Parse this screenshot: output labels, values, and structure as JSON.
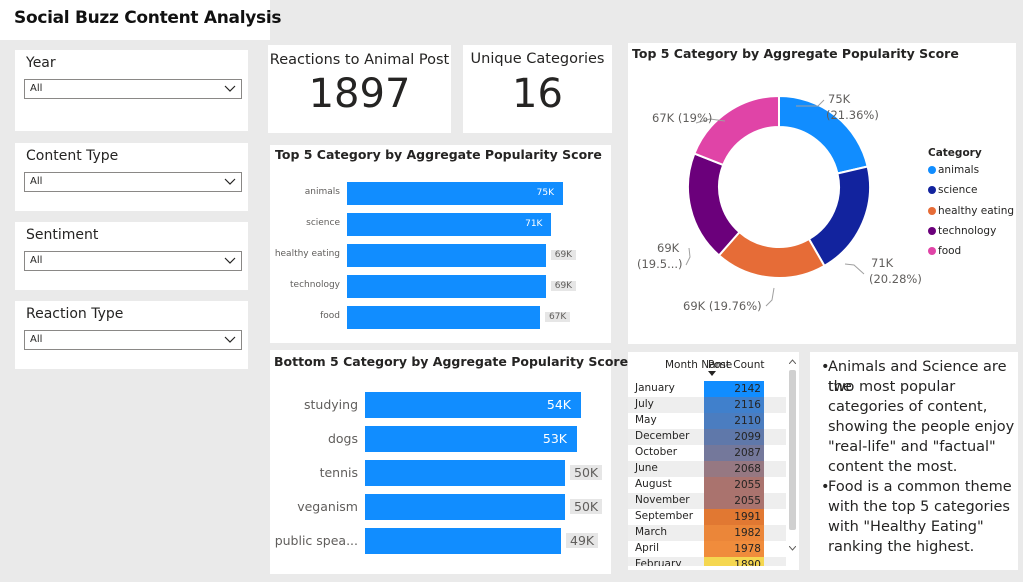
{
  "title": "Social Buzz Content Analysis",
  "slicers": [
    {
      "label": "Year",
      "value": "All"
    },
    {
      "label": "Content Type",
      "value": "All"
    },
    {
      "label": "Sentiment",
      "value": "All"
    },
    {
      "label": "Reaction Type",
      "value": "All"
    }
  ],
  "kpis": {
    "reactions": {
      "label": "Reactions to Animal Post",
      "value": "1897"
    },
    "categories": {
      "label": "Unique Categories",
      "value": "16"
    }
  },
  "top5_title": "Top 5 Category by Aggregate Popularity Score",
  "bottom5_title": "Bottom 5 Category by Aggregate Popularity Score",
  "donut_title": "Top 5 Category by Aggregate Popularity Score",
  "legend": {
    "title": "Category",
    "items": [
      "animals",
      "science",
      "healthy eating",
      "technology",
      "food"
    ]
  },
  "donut_labels": {
    "animals": [
      "75K",
      "(21.36%)"
    ],
    "science": [
      "71K",
      "(20.28%)"
    ],
    "healthy_eating": [
      "69K (19.76%)"
    ],
    "technology": [
      "69K",
      "(19.5...)"
    ],
    "food": [
      "67K (19%)"
    ]
  },
  "month_table": {
    "headers": [
      "Month Name",
      "Post Count"
    ],
    "rows": [
      {
        "month": "January",
        "count": "2142"
      },
      {
        "month": "July",
        "count": "2116"
      },
      {
        "month": "May",
        "count": "2110"
      },
      {
        "month": "December",
        "count": "2099"
      },
      {
        "month": "October",
        "count": "2087"
      },
      {
        "month": "June",
        "count": "2068"
      },
      {
        "month": "August",
        "count": "2055"
      },
      {
        "month": "November",
        "count": "2055"
      },
      {
        "month": "September",
        "count": "1991"
      },
      {
        "month": "March",
        "count": "1982"
      },
      {
        "month": "April",
        "count": "1978"
      },
      {
        "month": "February",
        "count": "1890"
      }
    ]
  },
  "notes": [
    [
      "Animals and Science are the",
      "two most popular",
      "categories of content,",
      "showing the people enjoy",
      "\"real-life\" and \"factual\"",
      "content the most."
    ],
    [
      "Food is a common theme",
      "with the top 5 categories",
      "with \"Healthy Eating\"",
      "ranking the highest."
    ]
  ],
  "colors": {
    "bar": "#118dff",
    "animals": "#118dff",
    "science": "#12239e",
    "healthy_eating": "#e66c37",
    "technology": "#6b007b",
    "food": "#e044a7"
  },
  "chart_data": [
    {
      "type": "bar",
      "title": "Top 5 Category by Aggregate Popularity Score",
      "categories": [
        "animals",
        "science",
        "healthy eating",
        "technology",
        "food"
      ],
      "values": [
        75,
        71,
        69,
        69,
        67
      ],
      "labels": [
        "75K",
        "71K",
        "69K",
        "69K",
        "67K"
      ]
    },
    {
      "type": "bar",
      "title": "Bottom 5 Category by Aggregate Popularity Score",
      "categories": [
        "studying",
        "dogs",
        "tennis",
        "veganism",
        "public spea..."
      ],
      "values": [
        54,
        53,
        50,
        50,
        49
      ],
      "labels": [
        "54K",
        "53K",
        "50K",
        "50K",
        "49K"
      ]
    },
    {
      "type": "pie",
      "title": "Top 5 Category by Aggregate Popularity Score",
      "categories": [
        "animals",
        "science",
        "healthy eating",
        "technology",
        "food"
      ],
      "values": [
        21.36,
        20.28,
        19.76,
        19.5,
        19
      ]
    },
    {
      "type": "table",
      "columns": [
        "Month Name",
        "Post Count"
      ],
      "values": [
        2142,
        2116,
        2110,
        2099,
        2087,
        2068,
        2055,
        2055,
        1991,
        1982,
        1978,
        1890
      ]
    }
  ]
}
